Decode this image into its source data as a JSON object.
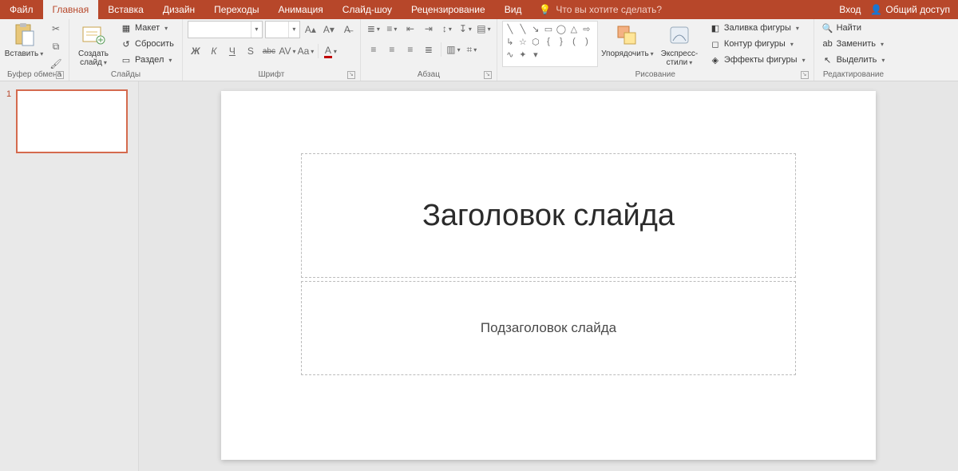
{
  "tabs": {
    "file": "Файл",
    "home": "Главная",
    "insert": "Вставка",
    "design": "Дизайн",
    "transitions": "Переходы",
    "animations": "Анимация",
    "slideshow": "Слайд-шоу",
    "review": "Рецензирование",
    "view": "Вид",
    "tellme": "Что вы хотите сделать?",
    "signin": "Вход",
    "share": "Общий доступ"
  },
  "ribbon": {
    "clipboard": {
      "label": "Буфер обмена",
      "paste": "Вставить"
    },
    "slides": {
      "label": "Слайды",
      "new_slide": "Создать слайд",
      "layout": "Макет",
      "reset": "Сбросить",
      "section": "Раздел"
    },
    "font": {
      "label": "Шрифт",
      "name_value": "",
      "size_value": "",
      "bold": "Ж",
      "italic": "К",
      "underline": "Ч",
      "shadow": "S",
      "strike": "abc",
      "spacing": "AV",
      "case": "Aa",
      "color": "A"
    },
    "paragraph": {
      "label": "Абзац"
    },
    "drawing": {
      "label": "Рисование",
      "arrange": "Упорядочить",
      "quick_styles": "Экспресс-стили",
      "fill": "Заливка фигуры",
      "outline": "Контур фигуры",
      "effects": "Эффекты фигуры"
    },
    "editing": {
      "label": "Редактирование",
      "find": "Найти",
      "replace": "Заменить",
      "select": "Выделить"
    }
  },
  "thumbs": {
    "n1": "1"
  },
  "slide": {
    "title_placeholder": "Заголовок слайда",
    "subtitle_placeholder": "Подзаголовок слайда"
  }
}
